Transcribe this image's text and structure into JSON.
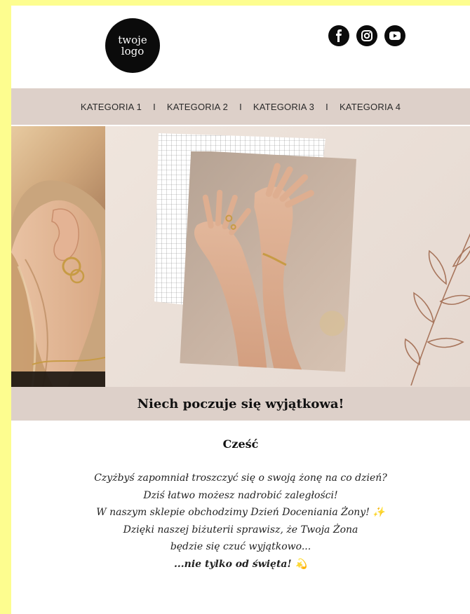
{
  "header": {
    "logo_line1": "twoje",
    "logo_line2": "logo",
    "social": [
      "facebook-icon",
      "instagram-icon",
      "youtube-icon"
    ]
  },
  "nav": {
    "items": [
      "KATEGORIA 1",
      "KATEGORIA 2",
      "KATEGORIA 3",
      "KATEGORIA 4"
    ],
    "separator": "I"
  },
  "hero": {
    "subtitle": "Niech poczuje się wyjątkowa!"
  },
  "content": {
    "greeting": "Cześć",
    "lines": [
      "Czyżbyś zapomniał troszczyć się o swoją żonę na co dzień?",
      "Dziś łatwo możesz nadrobić zaległości!",
      "W naszym sklepie obchodzimy Dzień Doceniania Żony! ✨",
      "Dzięki naszej biżuterii sprawisz, że Twoja Żona",
      "będzie się czuć wyjątkowo...",
      "...nie tylko od święta! 💫"
    ]
  },
  "colors": {
    "page_bg": "#fdfd8f",
    "nav_bg": "#ddd0c9",
    "accent_dark": "#0b0b0b"
  }
}
